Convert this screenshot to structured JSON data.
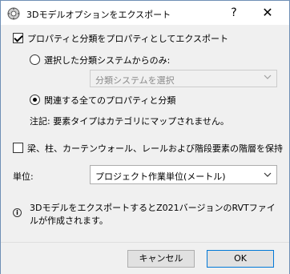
{
  "window": {
    "title": "3Dモデルオプションをエクスポート",
    "help": "?",
    "close": "✕"
  },
  "options": {
    "export_props": {
      "label": "プロパティと分類をプロパティとしてエクスポート",
      "checked": true
    },
    "radio_selected_system": {
      "label": "選択した分類システムからのみ:",
      "selected": false
    },
    "classification_dropdown": {
      "value": "分類システムを選択",
      "disabled": true
    },
    "radio_all_related": {
      "label": "関連する全てのプロパティと分類",
      "selected": true
    },
    "note": "注記: 要素タイプはカテゴリにマップされません。",
    "hierarchy": {
      "label": "梁、柱、カーテンウォール、レールおよび階段要素の階層を保持",
      "checked": false
    }
  },
  "units": {
    "label": "単位:",
    "value": "プロジェクト作業単位(メートル)"
  },
  "info": {
    "text": "3DモデルをエクスポートするとZ021バージョンのRVTファイルが作成されます。"
  },
  "buttons": {
    "cancel": "キャンセル",
    "ok": "OK"
  },
  "colors": {
    "accent": "#0078d7",
    "window_border": "#6f8fb5",
    "background": "#f0f0f0"
  }
}
